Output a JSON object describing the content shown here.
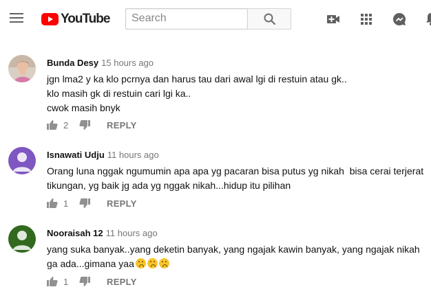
{
  "header": {
    "logo_text": "YouTube",
    "search_placeholder": "Search",
    "icons": [
      "menu-icon",
      "video-camera-add-icon",
      "apps-grid-icon",
      "messages-icon",
      "notifications-icon"
    ]
  },
  "comments": [
    {
      "author": "Bunda Desy",
      "time": "15 hours ago",
      "text": "jgn lma2 y ka klo pcrnya dan harus tau dari awal lgi di restuin atau gk..\nklo masih gk di restuin cari lgi ka..\ncwok masih bnyk",
      "likes": "2",
      "reply_label": "REPLY",
      "avatar": "photo"
    },
    {
      "author": "Isnawati Udju",
      "time": "11 hours ago",
      "text": "Orang luna nggak ngumumin apa apa yg pacaran bisa putus yg nikah  bisa cerai terjerat tikungan, yg baik jg ada yg nggak nikah...hidup itu pilihan",
      "likes": "1",
      "reply_label": "REPLY",
      "avatar_color": "#7e57c2"
    },
    {
      "author": "Nooraisah 12",
      "time": "11 hours ago",
      "text": "yang suka banyak..yang deketin banyak, yang ngajak kawin banyak, yang ngajak nikah ga ada...gimana yaa",
      "emoji_count": 3,
      "likes": "1",
      "reply_label": "REPLY",
      "avatar_color": "#33691e"
    }
  ]
}
